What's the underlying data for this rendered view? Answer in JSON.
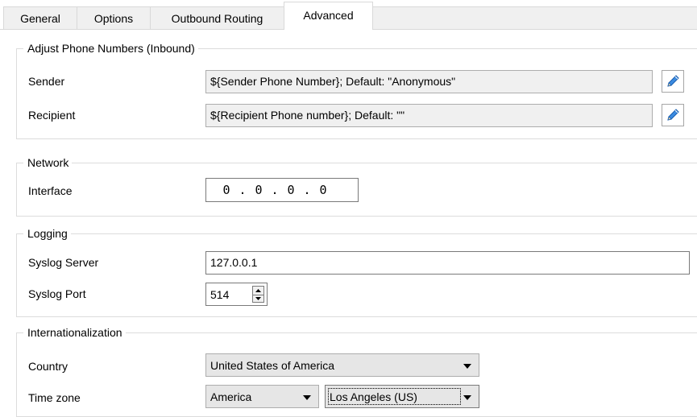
{
  "tabs": [
    {
      "label": "General",
      "active": false
    },
    {
      "label": "Options",
      "active": false
    },
    {
      "label": "Outbound Routing",
      "active": false
    },
    {
      "label": "Advanced",
      "active": true
    }
  ],
  "groups": {
    "adjust": {
      "title": "Adjust Phone Numbers (Inbound)",
      "sender_label": "Sender",
      "sender_value": "${Sender Phone Number}; Default: \"Anonymous\"",
      "recipient_label": "Recipient",
      "recipient_value": "${Recipient Phone number}; Default: \"\"",
      "edit_icon": "pencil-icon"
    },
    "network": {
      "title": "Network",
      "interface_label": "Interface",
      "ip": [
        "0",
        "0",
        "0",
        "0"
      ]
    },
    "logging": {
      "title": "Logging",
      "server_label": "Syslog Server",
      "server_value": "127.0.0.1",
      "port_label": "Syslog Port",
      "port_value": "514"
    },
    "i18n": {
      "title": "Internationalization",
      "country_label": "Country",
      "country_value": "United States of America",
      "timezone_label": "Time zone",
      "region_value": "America",
      "city_value": "Los Angeles (US)"
    }
  },
  "colors": {
    "pencil_blue": "#2f7fd8",
    "tab_bg": "#f0f0f0",
    "border": "#d9d9d9"
  }
}
